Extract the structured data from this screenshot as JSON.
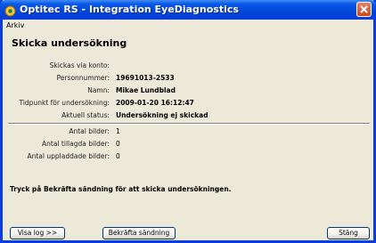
{
  "window": {
    "title": "Optitec RS - Integration EyeDiagnostics"
  },
  "menu": {
    "items": [
      "Arkiv"
    ]
  },
  "heading": "Skicka undersökning",
  "fields": [
    {
      "label": "Skickas via konto:",
      "value": ""
    },
    {
      "label": "Personnummer:",
      "value": "19691013-2533"
    },
    {
      "label": "Namn:",
      "value": "Mikae Lundblad"
    },
    {
      "label": "Tidpunkt för undersökning:",
      "value": "2009-01-20 16:12:47"
    },
    {
      "label": "Aktuell status:",
      "value": "Undersökning ej skickad"
    }
  ],
  "counts": [
    {
      "label": "Antal bilder:",
      "value": "1"
    },
    {
      "label": "Antal tillagda bilder:",
      "value": "0"
    },
    {
      "label": "Antal uppladdade bilder:",
      "value": "0"
    }
  ],
  "instruction": "Tryck på Bekräfta sändning för att skicka undersökningen.",
  "buttons": {
    "show_log": "Visa log >>",
    "confirm": "Bekräfta sändning",
    "close": "Stäng"
  },
  "colors": {
    "titlebar": "#0a59e8",
    "window_bg": "#ece9d8",
    "close": "#c8451f"
  }
}
